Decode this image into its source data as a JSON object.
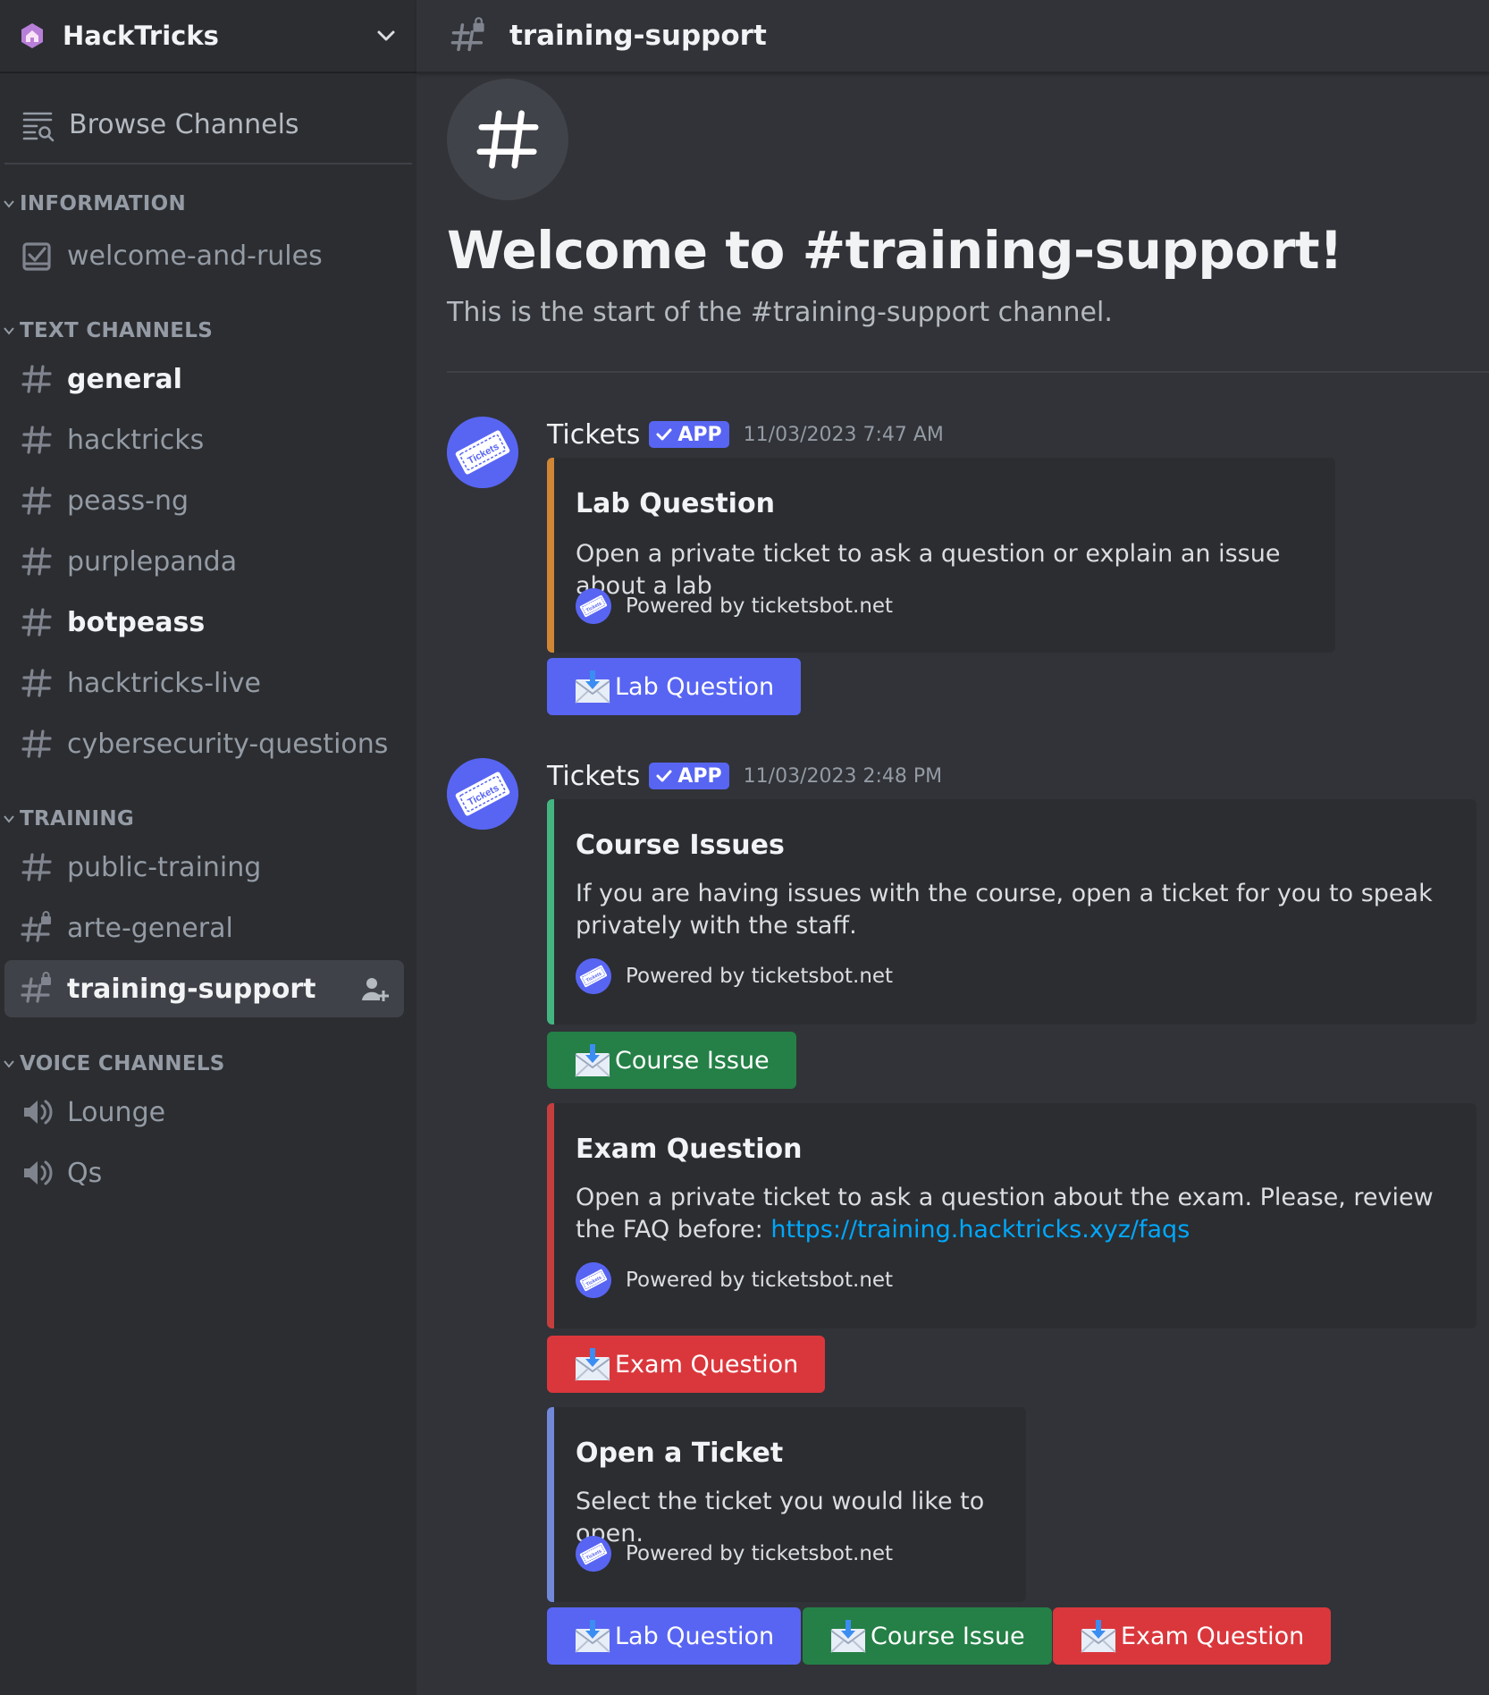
{
  "server": {
    "name": "HackTricks"
  },
  "sidebar": {
    "browse_label": "Browse Channels",
    "categories": [
      {
        "label": "INFORMATION",
        "channels": [
          {
            "label": "welcome-and-rules",
            "icon": "rules-check-icon"
          }
        ]
      },
      {
        "label": "TEXT CHANNELS",
        "channels": [
          {
            "label": "general",
            "icon": "hash-icon",
            "unread": true
          },
          {
            "label": "hacktricks",
            "icon": "hash-icon"
          },
          {
            "label": "peass-ng",
            "icon": "hash-icon"
          },
          {
            "label": "purplepanda",
            "icon": "hash-icon"
          },
          {
            "label": "botpeass",
            "icon": "hash-icon",
            "unread": true
          },
          {
            "label": "hacktricks-live",
            "icon": "hash-icon"
          },
          {
            "label": "cybersecurity-questions",
            "icon": "hash-icon"
          }
        ]
      },
      {
        "label": "TRAINING",
        "channels": [
          {
            "label": "public-training",
            "icon": "hash-icon"
          },
          {
            "label": "arte-general",
            "icon": "locked-hash-icon"
          },
          {
            "label": "training-support",
            "icon": "locked-hash-icon",
            "selected": true
          }
        ]
      },
      {
        "label": "VOICE CHANNELS",
        "channels": [
          {
            "label": "Lounge",
            "icon": "speaker-icon"
          },
          {
            "label": "Qs",
            "icon": "speaker-icon"
          }
        ]
      }
    ]
  },
  "header": {
    "channel_name": "training-support"
  },
  "welcome": {
    "title": "Welcome to #training-support!",
    "subtitle": "This is the start of the #training-support channel."
  },
  "messages": [
    {
      "author": "Tickets",
      "app_tag": "APP",
      "timestamp": "11/03/2023 7:47 AM",
      "embeds": [
        {
          "title": "Lab Question",
          "description": "Open a private ticket to ask a question or explain an issue about a lab",
          "footer": "Powered by ticketsbot.net",
          "color": "#d08635",
          "buttons": [
            {
              "label": "Lab Question",
              "color": "#5865f2"
            }
          ]
        }
      ]
    },
    {
      "author": "Tickets",
      "app_tag": "APP",
      "timestamp": "11/03/2023 2:48 PM",
      "embeds": [
        {
          "title": "Course Issues",
          "description": "If you are having issues with the course, open a ticket for you to speak privately with the staff.",
          "footer": "Powered by ticketsbot.net",
          "color": "#43b581",
          "buttons": [
            {
              "label": "Course Issue",
              "color": "#248046"
            }
          ]
        },
        {
          "title": "Exam Question",
          "description_prefix": "Open a private ticket to ask a question about the exam. Please, review the FAQ before: ",
          "link": "https://training.hacktricks.xyz/faqs",
          "footer": "Powered by ticketsbot.net",
          "color": "#c53e3e",
          "buttons": [
            {
              "label": "Exam Question",
              "color": "#da373c"
            }
          ]
        },
        {
          "title": "Open a Ticket",
          "description": "Select the ticket you would like to open.",
          "footer": "Powered by ticketsbot.net",
          "color": "#7289da",
          "buttons": [
            {
              "label": "Lab Question",
              "color": "#5865f2"
            },
            {
              "label": "Course Issue",
              "color": "#248046"
            },
            {
              "label": "Exam Question",
              "color": "#da373c"
            }
          ]
        }
      ]
    }
  ]
}
